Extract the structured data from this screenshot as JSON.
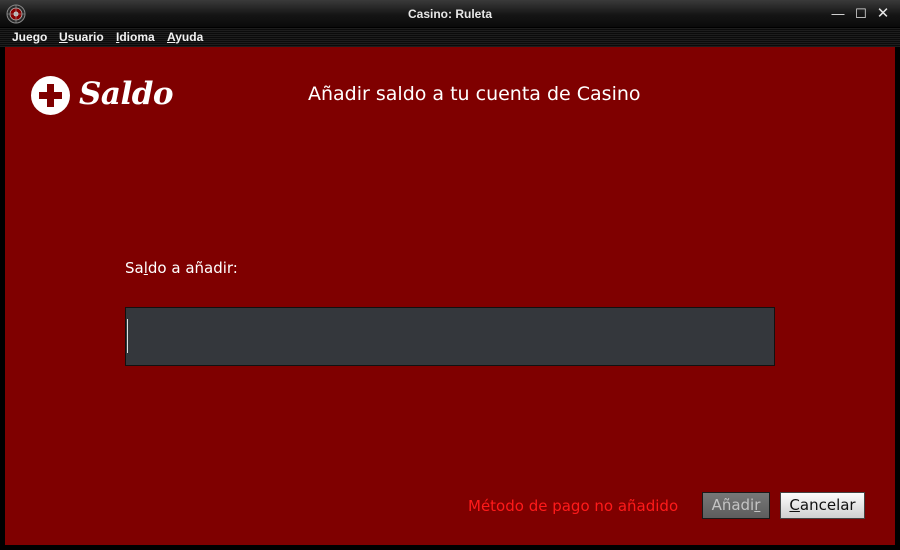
{
  "window": {
    "title": "Casino: Ruleta",
    "controls": {
      "minimize": "—",
      "maximize": "☐",
      "close": "✕"
    }
  },
  "menu": [
    {
      "pre": "Jue",
      "mnemonic": "g",
      "post": "o"
    },
    {
      "pre": "",
      "mnemonic": "U",
      "post": "suario"
    },
    {
      "pre": "",
      "mnemonic": "I",
      "post": "dioma"
    },
    {
      "pre": "",
      "mnemonic": "A",
      "post": "yuda"
    }
  ],
  "header": {
    "logo_text": "Saldo",
    "title": "Añadir saldo a tu cuenta de Casino"
  },
  "form": {
    "label_pre": "Sa",
    "label_mnemonic": "l",
    "label_post": "do a añadir:",
    "amount_value": ""
  },
  "status": {
    "message": "Método de pago no añadido",
    "color": "#ff1a1a"
  },
  "buttons": {
    "add": {
      "pre": "Añadi",
      "mnemonic": "r",
      "post": "",
      "enabled": false
    },
    "cancel": {
      "pre": "",
      "mnemonic": "C",
      "post": "ancelar",
      "enabled": true
    }
  },
  "colors": {
    "background": "#7f0000",
    "input_bg": "#34373c"
  }
}
